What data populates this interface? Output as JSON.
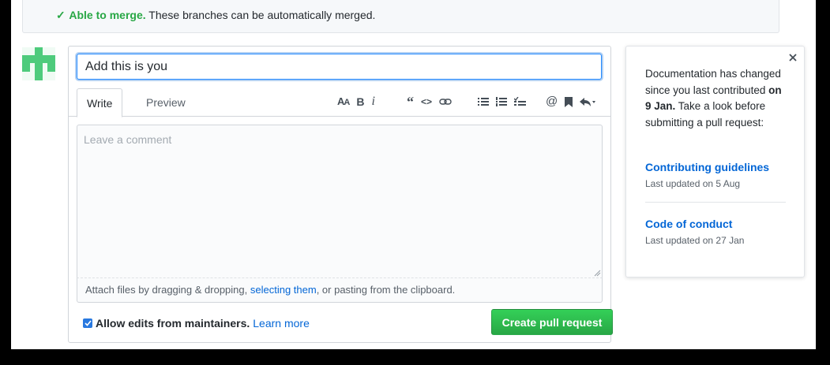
{
  "merge": {
    "status_label": "Able to merge.",
    "description": "These branches can be automatically merged.",
    "check_icon": "check-icon",
    "status_color": "#28a745"
  },
  "form": {
    "title_value": "Add this is you",
    "tabs": [
      {
        "label": "Write",
        "active": true
      },
      {
        "label": "Preview",
        "active": false
      }
    ],
    "toolbar_icons": [
      "text-size-icon",
      "bold-icon",
      "italic-icon",
      "quote-icon",
      "code-icon",
      "link-icon",
      "bullet-list-icon",
      "numbered-list-icon",
      "task-list-icon",
      "mention-icon",
      "saved-reply-icon",
      "reply-icon"
    ],
    "comment_placeholder": "Leave a comment",
    "attach": {
      "before": "Attach files by dragging & dropping,",
      "link": "selecting them",
      "after": ", or pasting from the clipboard."
    },
    "allow_edits_label": "Allow edits from maintainers.",
    "allow_edits_checked": true,
    "learn_more": "Learn more",
    "submit_label": "Create pull request",
    "submit_color": "#28a745"
  },
  "popover": {
    "text_before": "Documentation has changed since you last contributed",
    "text_bold": "on 9 Jan.",
    "text_after": "Take a look before submitting a pull request:",
    "links": [
      {
        "label": "Contributing guidelines",
        "meta": "Last updated on 5 Aug"
      },
      {
        "label": "Code of conduct",
        "meta": "Last updated on 27 Jan"
      }
    ],
    "close_icon": "close-icon"
  },
  "colors": {
    "accent": "#0366d6",
    "avatar": "#4ecb7c"
  }
}
